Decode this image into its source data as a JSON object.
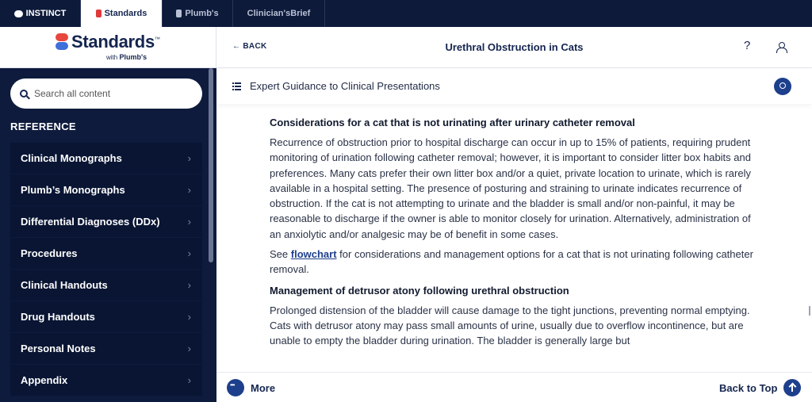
{
  "product_tabs": [
    {
      "label": "INSTINCT",
      "icon": "cloud-icon"
    },
    {
      "label": "Standards",
      "icon": "standards-logo-icon",
      "active": true
    },
    {
      "label": "Plumb's",
      "icon": "plumbs-logo-icon"
    },
    {
      "label": "Clinician'sBrief",
      "icon": ""
    }
  ],
  "logo": {
    "text": "Standards",
    "tm": "™",
    "sub_with": "with",
    "sub_brand": "Plumb's"
  },
  "search": {
    "placeholder": "Search all content"
  },
  "sidebar": {
    "section_title": "REFERENCE",
    "items": [
      {
        "label": "Clinical Monographs"
      },
      {
        "label": "Plumb’s Monographs"
      },
      {
        "label": "Differential Diagnoses (DDx)"
      },
      {
        "label": "Procedures"
      },
      {
        "label": "Clinical Handouts"
      },
      {
        "label": "Drug Handouts"
      },
      {
        "label": "Personal Notes"
      },
      {
        "label": "Appendix"
      }
    ]
  },
  "header": {
    "back_label": "BACK",
    "title": "Urethral Obstruction in Cats",
    "help": "?"
  },
  "section": {
    "title": "Expert Guidance to Clinical Presentations"
  },
  "content": {
    "heading1": "Considerations for a cat that is not urinating after urinary catheter removal",
    "para1": "Recurrence of obstruction prior to hospital discharge can occur in up to 15% of patients, requiring prudent monitoring of urination following catheter removal; however, it is important to consider litter box habits and preferences. Many cats prefer their own litter box and/or a quiet, private location to urinate, which is rarely available in a hospital setting. The presence of posturing and straining to urinate indicates recurrence of obstruction. If the cat is not attempting to urinate and the bladder is small and/or non-painful, it may be reasonable to discharge if the owner is able to monitor closely for urination. Alternatively, administration of an anxiolytic and/or analgesic may be of benefit in some cases.",
    "see_prefix": "See ",
    "see_link": "flowchart",
    "see_suffix": " for considerations and management options for a cat that is not urinating following catheter removal.",
    "heading2": "Management of detrusor atony following urethral obstruction",
    "para2": "Prolonged distension of the bladder will cause damage to the tight junctions, preventing normal emptying. Cats with detrusor atony may pass small amounts of urine, usually due to overflow incontinence, but are unable to empty the bladder during urination. The bladder is generally large but"
  },
  "footer": {
    "more_label": "More",
    "top_label": "Back to Top"
  },
  "colors": {
    "navy": "#0e1b3d",
    "accent": "#1d3f8c",
    "logo_red": "#e8473d",
    "logo_blue": "#3f6fd8"
  }
}
